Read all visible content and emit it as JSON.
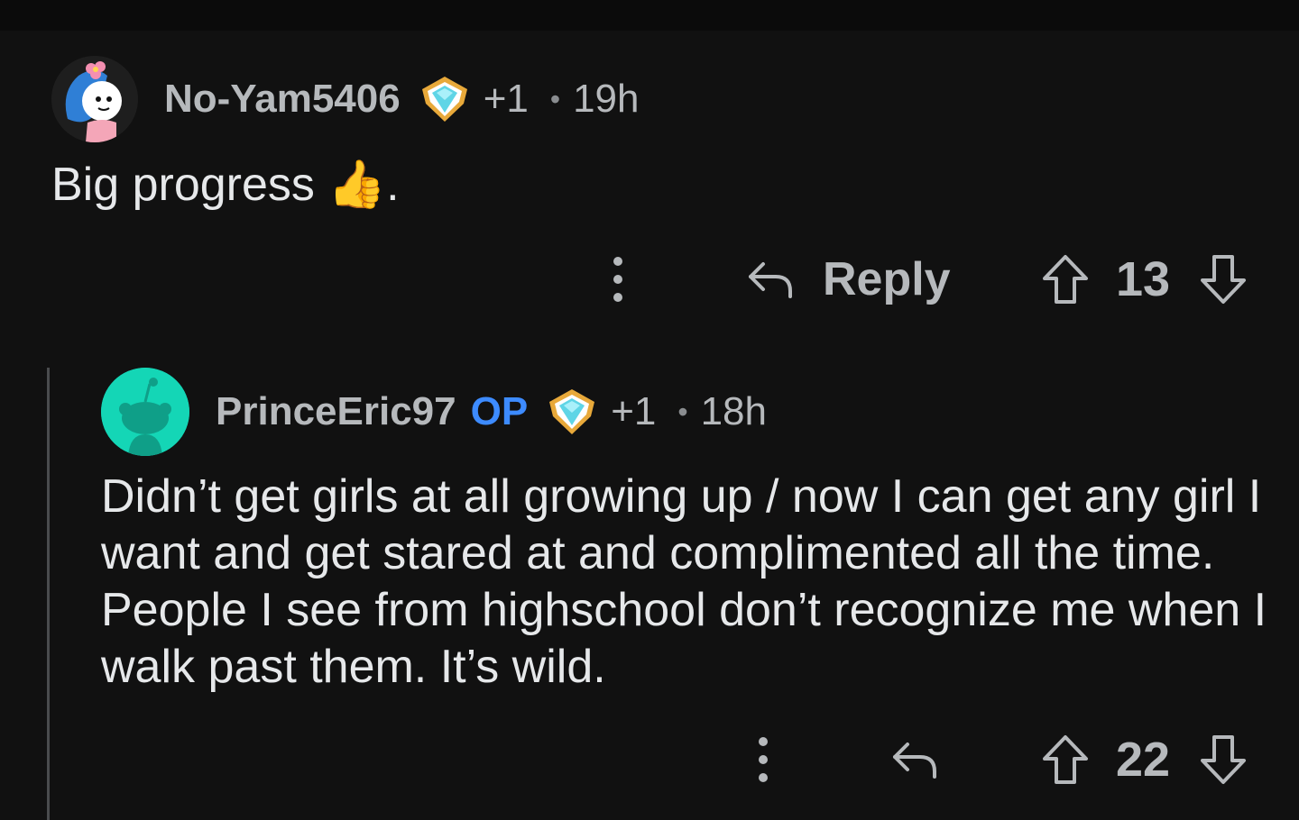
{
  "comments": [
    {
      "username": "No-Yam5406",
      "op_label": "",
      "award_count": "+1",
      "separator": "•",
      "time": "19h",
      "body": "Big progress 👍.",
      "reply_label": "Reply",
      "score": "13"
    },
    {
      "username": "PrinceEric97",
      "op_label": "OP",
      "award_count": "+1",
      "separator": "•",
      "time": "18h",
      "body": "Didn’t get girls at all growing up / now I can get any girl I want and get stared at and complimented all the time. People I see from highschool don’t recognize me when I walk past them. It’s wild.",
      "reply_label": "",
      "score": "22"
    }
  ],
  "icons": {
    "award": "diamond-award-icon",
    "more": "more-vertical-icon",
    "reply": "reply-arrow-icon",
    "upvote": "upvote-arrow-icon",
    "downvote": "downvote-arrow-icon"
  },
  "colors": {
    "background": "#111111",
    "op_accent": "#3d8bff",
    "avatar_teal": "#14d6b6",
    "award_gold": "#e8a93a",
    "award_gem": "#5fd5e6"
  }
}
